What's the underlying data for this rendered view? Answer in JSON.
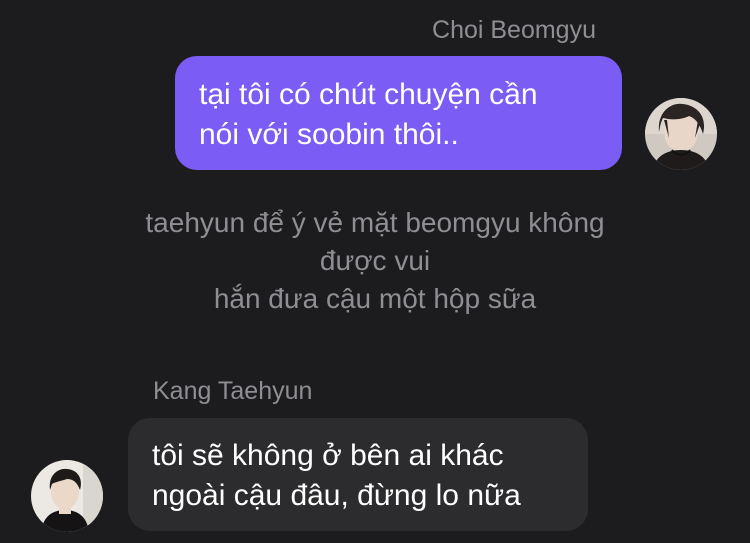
{
  "messages": [
    {
      "sender": "Choi Beomgyu",
      "lines": [
        "tại tôi có chút chuyện cần",
        "nói với soobin thôi.."
      ],
      "bubble_color": "#7b5cf5",
      "side": "right"
    },
    {
      "sender": "Kang Taehyun",
      "lines": [
        "tôi sẽ không ở bên ai khác",
        "ngoài cậu đâu, đừng lo nữa"
      ],
      "bubble_color": "#2c2c2e",
      "side": "left"
    }
  ],
  "narration": {
    "lines": [
      "taehyun để ý vẻ mặt beomgyu không",
      "được vui",
      "hắn đưa cậu một hộp sữa"
    ]
  },
  "avatars": {
    "top": "avatar-photo-icon",
    "bottom": "avatar-photo-icon"
  },
  "colors": {
    "background": "#1c1c1e",
    "secondary_text": "#8e8e93",
    "text": "#ffffff"
  }
}
